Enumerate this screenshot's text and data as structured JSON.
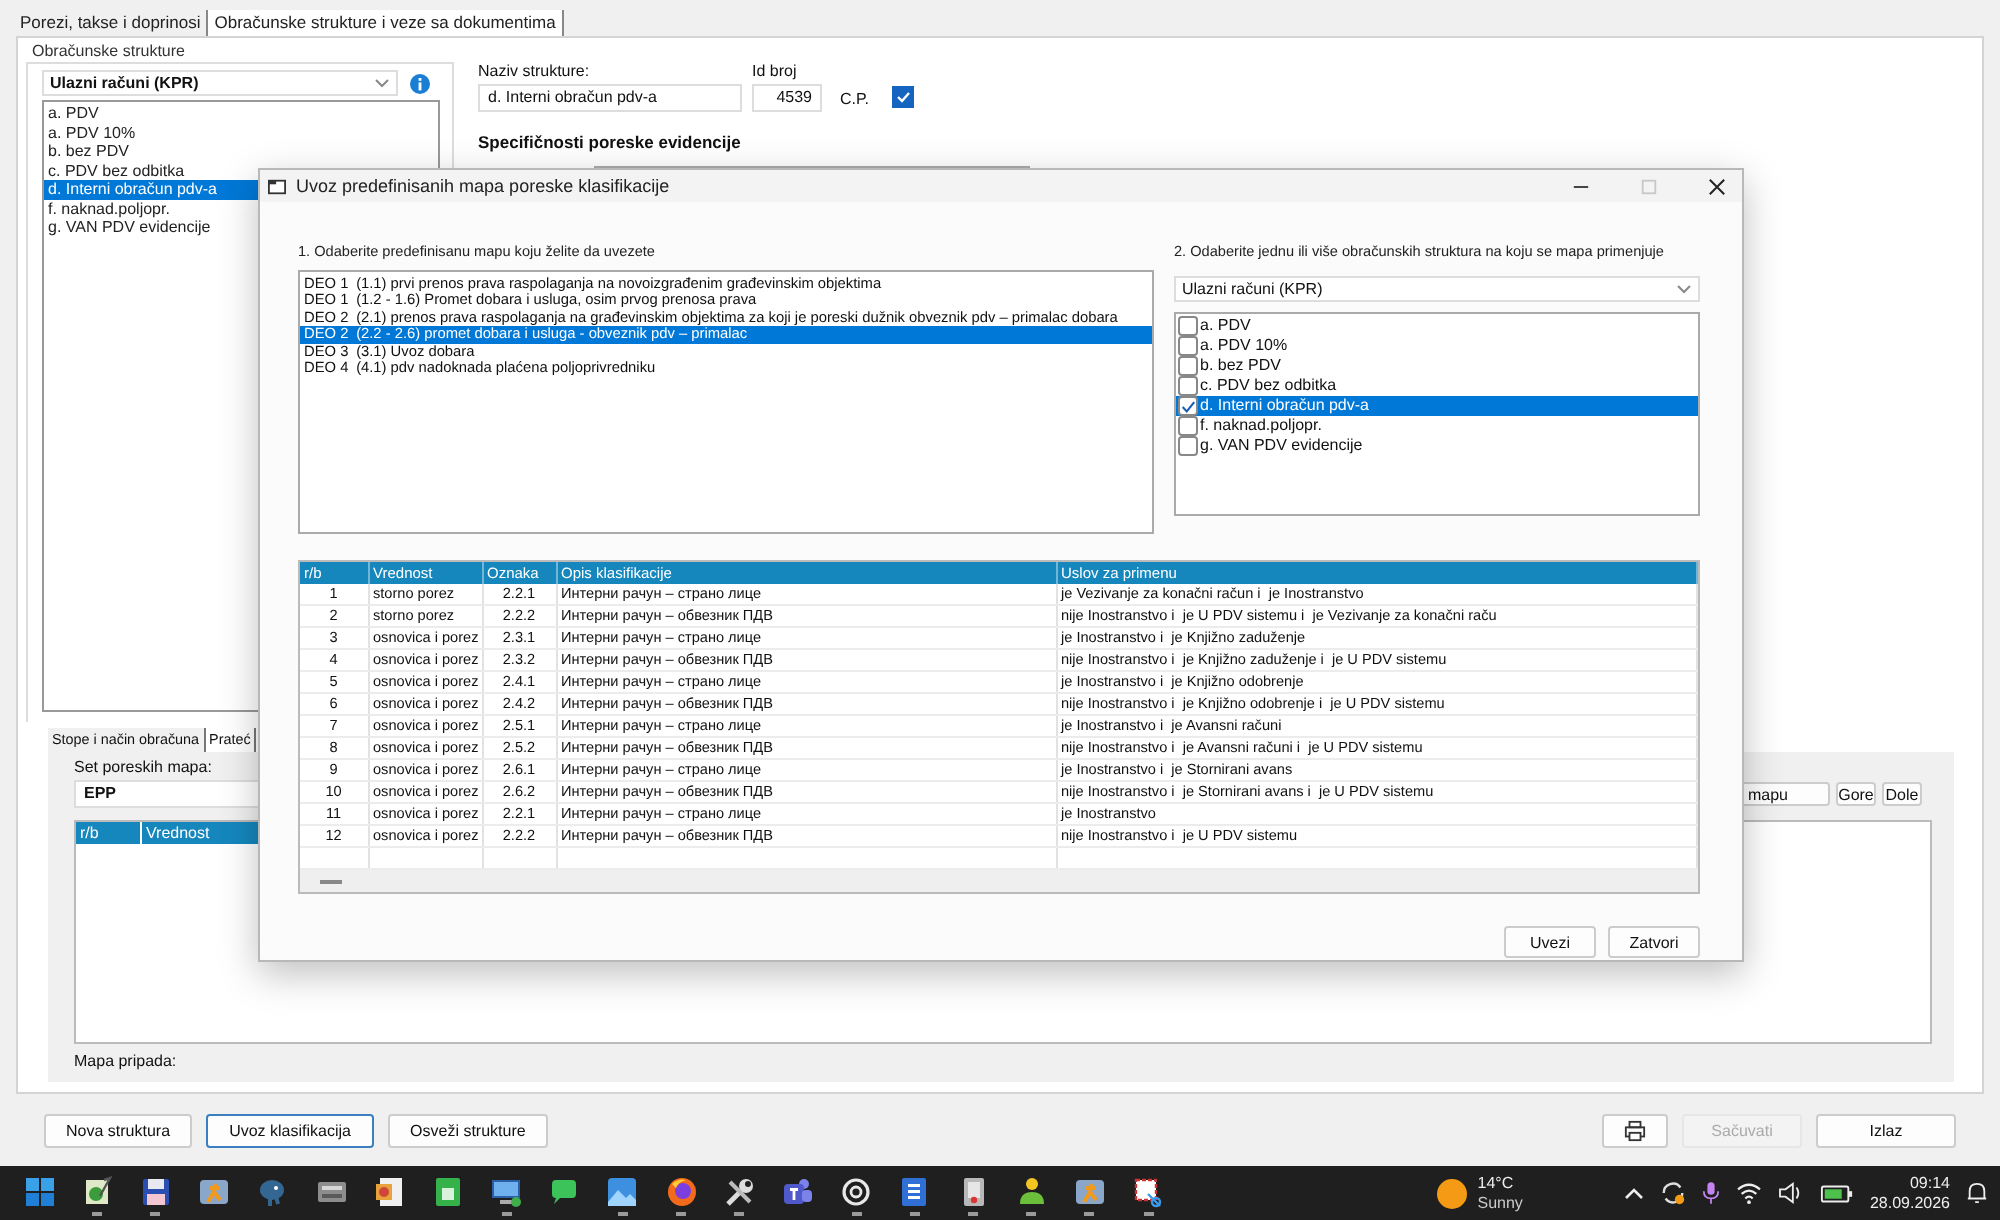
{
  "tabs": [
    {
      "label": "Porezi, takse i doprinosi",
      "selected": false
    },
    {
      "label": "Obračunske strukture i veze sa dokumentima",
      "selected": true
    }
  ],
  "structures": {
    "legend": "Obračunske strukture",
    "type_select": "Ulazni računi (KPR)",
    "items": [
      {
        "label": "a. PDV",
        "selected": false
      },
      {
        "label": "a. PDV 10%",
        "selected": false
      },
      {
        "label": "b. bez PDV",
        "selected": false
      },
      {
        "label": "c. PDV bez odbitka",
        "selected": false
      },
      {
        "label": "d. Interni obračun pdv-a",
        "selected": true
      },
      {
        "label": "f. naknad.poljopr.",
        "selected": false
      },
      {
        "label": "g. VAN PDV evidencije",
        "selected": false
      }
    ]
  },
  "details": {
    "name_label": "Naziv strukture:",
    "name_value": "d. Interni obračun pdv-a",
    "id_label": "Id broj",
    "id_value": "4539",
    "cp_label": "C.P.",
    "cp_checked": true,
    "section_title": "Specifičnosti poreske evidencije"
  },
  "lower_tabs": [
    {
      "label": "Stope i način obračuna",
      "selected": true
    },
    {
      "label": "Prateć",
      "selected": false
    }
  ],
  "tax_maps": {
    "set_label": "Set poreskih mapa:",
    "set_value": "EPP",
    "columns": [
      "r/b",
      "Vrednost"
    ],
    "owner_label": "Mapa pripada:",
    "buttons": [
      "mapu",
      "Gore",
      "Dole"
    ]
  },
  "footer_buttons": [
    {
      "kind": "text",
      "label": "Nova struktura",
      "focused": false,
      "disabled": false
    },
    {
      "kind": "text",
      "label": "Uvoz klasifikacija",
      "focused": true,
      "disabled": false
    },
    {
      "kind": "text",
      "label": "Osveži strukture",
      "focused": false,
      "disabled": false
    },
    {
      "kind": "print",
      "focused": false,
      "disabled": false
    },
    {
      "kind": "text",
      "label": "Sačuvati",
      "focused": false,
      "disabled": true
    },
    {
      "kind": "text",
      "label": "Izlaz",
      "focused": false,
      "disabled": false
    }
  ],
  "dialog": {
    "title": "Uvoz predefinisanih mapa poreske klasifikacije",
    "step1_label": "1. Odaberite predefinisanu mapu koju želite da uvezete",
    "maps": [
      {
        "code": "DEO 1",
        "text": "(1.1) prvi prenos prava raspolaganja na novoizgrađenim građevinskim objektima",
        "selected": false
      },
      {
        "code": "DEO 1",
        "text": "(1.2 - 1.6) Promet dobara i usluga, osim prvog prenosa prava",
        "selected": false
      },
      {
        "code": "DEO 2",
        "text": "(2.1) prenos prava raspolaganja na građevinskim objektima za koji je poreski dužnik obveznik pdv – primalac dobara",
        "selected": false
      },
      {
        "code": "DEO 2",
        "text": "(2.2 - 2.6) promet dobara i usluga - obveznik pdv – primalac",
        "selected": true
      },
      {
        "code": "DEO 3",
        "text": "(3.1) Uvoz dobara",
        "selected": false
      },
      {
        "code": "DEO 4",
        "text": "(4.1) pdv nadoknada plaćena poljoprivredniku",
        "selected": false
      }
    ],
    "step2_label": "2. Odaberite jednu ili više obračunskih struktura na koju se mapa primenjuje",
    "type_select": "Ulazni računi (KPR)",
    "structures": [
      {
        "label": "a. PDV",
        "checked": false,
        "selected": false
      },
      {
        "label": "a. PDV 10%",
        "checked": false,
        "selected": false
      },
      {
        "label": "b. bez PDV",
        "checked": false,
        "selected": false
      },
      {
        "label": "c. PDV bez odbitka",
        "checked": false,
        "selected": false
      },
      {
        "label": "d. Interni obračun pdv-a",
        "checked": true,
        "selected": true
      },
      {
        "label": "f. naknad.poljopr.",
        "checked": false,
        "selected": false
      },
      {
        "label": "g. VAN PDV evidencije",
        "checked": false,
        "selected": false
      }
    ],
    "table": {
      "columns": [
        "r/b",
        "Vrednost",
        "Oznaka",
        "Opis klasifikacije",
        "Uslov za primenu"
      ],
      "rows": [
        {
          "rb": "1",
          "value": "storno porez",
          "code": "2.2.1",
          "description": "Интерни рачун – страно лице",
          "condition": "je Vezivanje za konačni račun i  je Inostranstvo"
        },
        {
          "rb": "2",
          "value": "storno porez",
          "code": "2.2.2",
          "description": "Интерни рачун – обвезник ПДВ",
          "condition": "nije Inostranstvo i  je U PDV sistemu i  je Vezivanje za konačni raču"
        },
        {
          "rb": "3",
          "value": "osnovica i porez",
          "code": "2.3.1",
          "description": "Интерни рачун – страно лице",
          "condition": "je Inostranstvo i  je Knjižno zaduženje"
        },
        {
          "rb": "4",
          "value": "osnovica i porez",
          "code": "2.3.2",
          "description": "Интерни рачун – обвезник ПДВ",
          "condition": "nije Inostranstvo i  je Knjižno zaduženje i  je U PDV sistemu"
        },
        {
          "rb": "5",
          "value": "osnovica i porez",
          "code": "2.4.1",
          "description": "Интерни рачун – страно лице",
          "condition": "je Inostranstvo i  je Knjižno odobrenje"
        },
        {
          "rb": "6",
          "value": "osnovica i porez",
          "code": "2.4.2",
          "description": "Интерни рачун – обвезник ПДВ",
          "condition": "nije Inostranstvo i  je Knjižno odobrenje i  je U PDV sistemu"
        },
        {
          "rb": "7",
          "value": "osnovica i porez",
          "code": "2.5.1",
          "description": "Интерни рачун – страно лице",
          "condition": "je Inostranstvo i  je Avansni računi"
        },
        {
          "rb": "8",
          "value": "osnovica i porez",
          "code": "2.5.2",
          "description": "Интерни рачун – обвезник ПДВ",
          "condition": "nije Inostranstvo i  je Avansni računi i  je U PDV sistemu"
        },
        {
          "rb": "9",
          "value": "osnovica i porez",
          "code": "2.6.1",
          "description": "Интерни рачун – страно лице",
          "condition": "je Inostranstvo i  je Stornirani avans"
        },
        {
          "rb": "10",
          "value": "osnovica i porez",
          "code": "2.6.2",
          "description": "Интерни рачун – обвезник ПДВ",
          "condition": "nije Inostranstvo i  je Stornirani avans i  je U PDV sistemu"
        },
        {
          "rb": "11",
          "value": "osnovica i porez",
          "code": "2.2.1",
          "description": "Интерни рачун – страно лице",
          "condition": "je Inostranstvo"
        },
        {
          "rb": "12",
          "value": "osnovica i porez",
          "code": "2.2.2",
          "description": "Интерни рачун – обвезник ПДВ",
          "condition": "nije Inostranstvo i  je U PDV sistemu"
        }
      ]
    },
    "buttons": [
      "Uvezi",
      "Zatvori"
    ]
  },
  "taskbar": {
    "apps": [
      {
        "kind": "start",
        "running": false
      },
      {
        "kind": "notepad",
        "running": true
      },
      {
        "kind": "floppy",
        "running": true
      },
      {
        "kind": "runner",
        "running": false
      },
      {
        "kind": "elephant",
        "running": false
      },
      {
        "kind": "scanner",
        "running": false
      },
      {
        "kind": "office",
        "running": false
      },
      {
        "kind": "sheet",
        "running": false
      },
      {
        "kind": "computer",
        "running": true
      },
      {
        "kind": "chat",
        "running": false
      },
      {
        "kind": "photos",
        "running": true
      },
      {
        "kind": "browser",
        "running": true
      },
      {
        "kind": "tools",
        "running": true
      },
      {
        "kind": "people",
        "running": false
      },
      {
        "kind": "knot",
        "running": true
      },
      {
        "kind": "doc",
        "running": true
      },
      {
        "kind": "device",
        "running": true
      },
      {
        "kind": "person",
        "running": true
      },
      {
        "kind": "runner",
        "running": true
      },
      {
        "kind": "snip",
        "running": true
      }
    ],
    "weather": {
      "temp": "14°C",
      "condition": "Sunny"
    },
    "clock": {
      "time": "09:14",
      "date": "28.09.2026"
    }
  }
}
